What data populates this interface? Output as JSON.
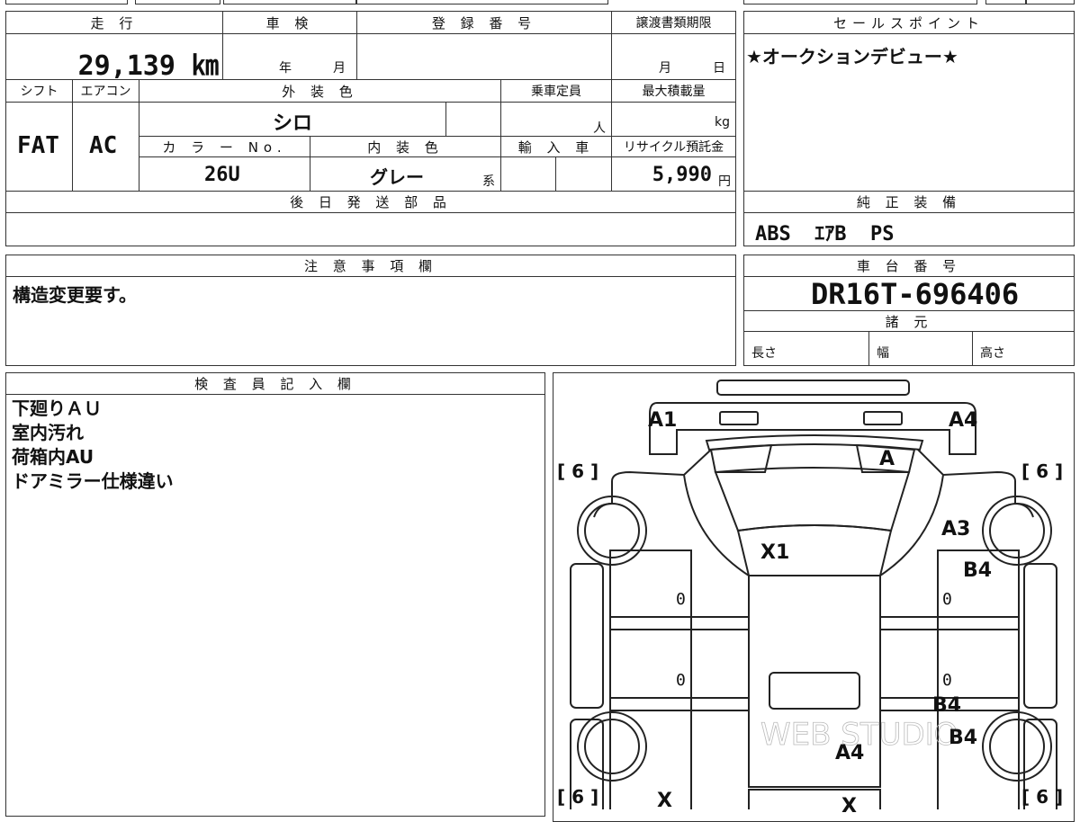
{
  "vehicle": {
    "mileage_label": "走 行",
    "mileage_value": "29,139 ㎞",
    "inspection_label": "車 検",
    "inspection_year": "年",
    "inspection_month": "月",
    "registration_label": "登 録 番 号",
    "transfer_label": "譲渡書類期限",
    "transfer_month": "月",
    "transfer_day": "日",
    "shift_label": "シフト",
    "shift_value": "FAT",
    "ac_label": "エアコン",
    "ac_value": "AC",
    "exterior_label": "外 装 色",
    "exterior_value": "シロ",
    "capacity_label": "乗車定員",
    "capacity_unit": "人",
    "load_label": "最大積載量",
    "load_unit": "kg",
    "color_no_label": "カ ラ ー No.",
    "color_no_value": "26U",
    "interior_label": "内 装 色",
    "interior_value": "グレー",
    "interior_suffix": "系",
    "import_label": "輸 入 車",
    "recycle_label": "リサイクル預託金",
    "recycle_value": "5,990",
    "recycle_unit": "円",
    "later_parts_label": "後 日 発 送 部 品"
  },
  "sales": {
    "label": "セールスポイント",
    "text": "★オークションデビュー★"
  },
  "equipment": {
    "label": "純 正 装 備",
    "value": "ABS  ｴｱB  PS"
  },
  "notes": {
    "label": "注 意 事 項 欄",
    "text": "構造変更要す。"
  },
  "chassis": {
    "label": "車 台 番 号",
    "value": "DR16T-696406",
    "spec_label": "諸 元",
    "length_label": "長さ",
    "width_label": "幅",
    "height_label": "高さ"
  },
  "inspector": {
    "label": "検 査 員 記 入 欄",
    "lines": [
      "下廻りＡＵ",
      "室内汚れ",
      "荷箱内AU",
      "ドアミラー仕様違い"
    ]
  },
  "diagram": {
    "tire_tl": "[ 6 ]",
    "tire_tr": "[ 6 ]",
    "tire_bl": "[ 6 ]",
    "tire_br": "[ 6 ]",
    "m_a1": "A1",
    "m_a4_top": "A4",
    "m_a": "A",
    "m_a3": "A3",
    "m_x1": "X1",
    "m_b4_r1": "B4",
    "m_b4_r2": "B4",
    "m_b4_r3": "B4",
    "m_a4_bed": "A4",
    "m_x_left": "X",
    "m_x_bottom": "X",
    "m_zero_1": "0",
    "m_zero_2": "0",
    "m_zero_3": "0",
    "m_zero_4": "0",
    "watermark": "WEB STUDIO"
  }
}
